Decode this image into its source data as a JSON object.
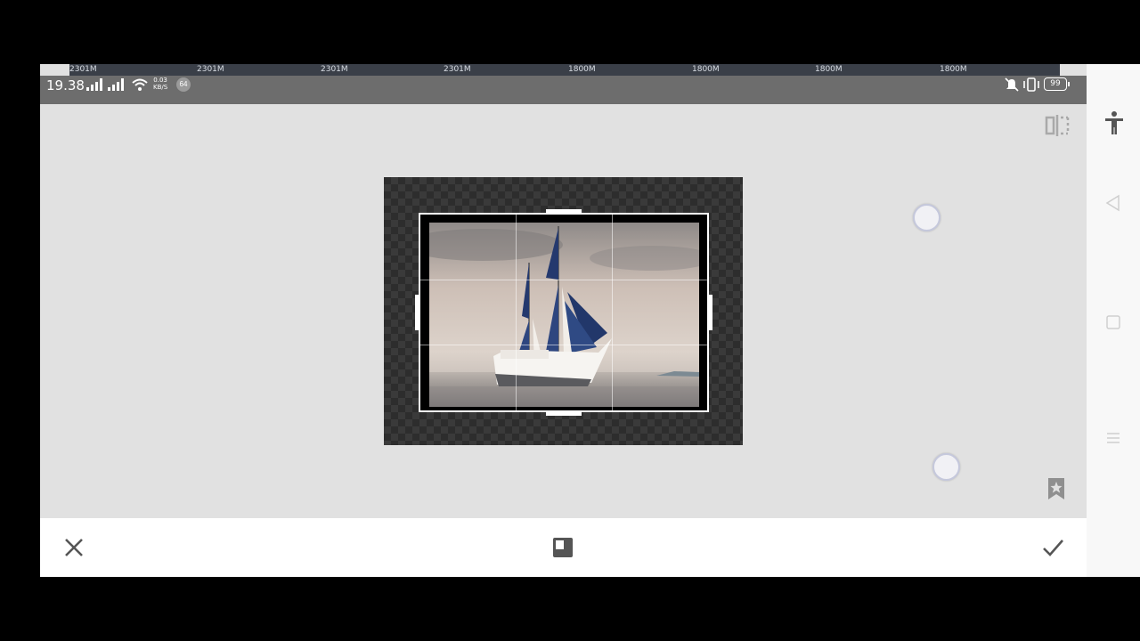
{
  "cpu_overlay": {
    "frequencies": [
      "2301M",
      "2301M",
      "2301M",
      "2301M",
      "1800M",
      "1800M",
      "1800M",
      "1800M"
    ]
  },
  "status_bar": {
    "time": "19.38",
    "net_speed_value": "0.03",
    "net_speed_unit": "KB/S",
    "notification_badge": "64",
    "battery": "99",
    "icons": [
      "signal-icon",
      "signal-icon",
      "wifi-icon",
      "mute-icon",
      "vibrate-icon",
      "battery-icon"
    ]
  },
  "editor": {
    "tool": "crop",
    "icons": [
      "compare-icon",
      "bookmark-icon"
    ]
  },
  "toolbar": {
    "icons": [
      "close-icon",
      "aspect-ratio-icon",
      "confirm-icon"
    ]
  },
  "navigation": {
    "icons": [
      "accessibility-icon",
      "back-icon",
      "home-icon",
      "menu-icon"
    ]
  },
  "colors": {
    "canvas_bg": "#e1e1e1",
    "status_bar": "#6d6d6d",
    "toolbar": "#ffffff",
    "accent_sail": "#24396e"
  }
}
